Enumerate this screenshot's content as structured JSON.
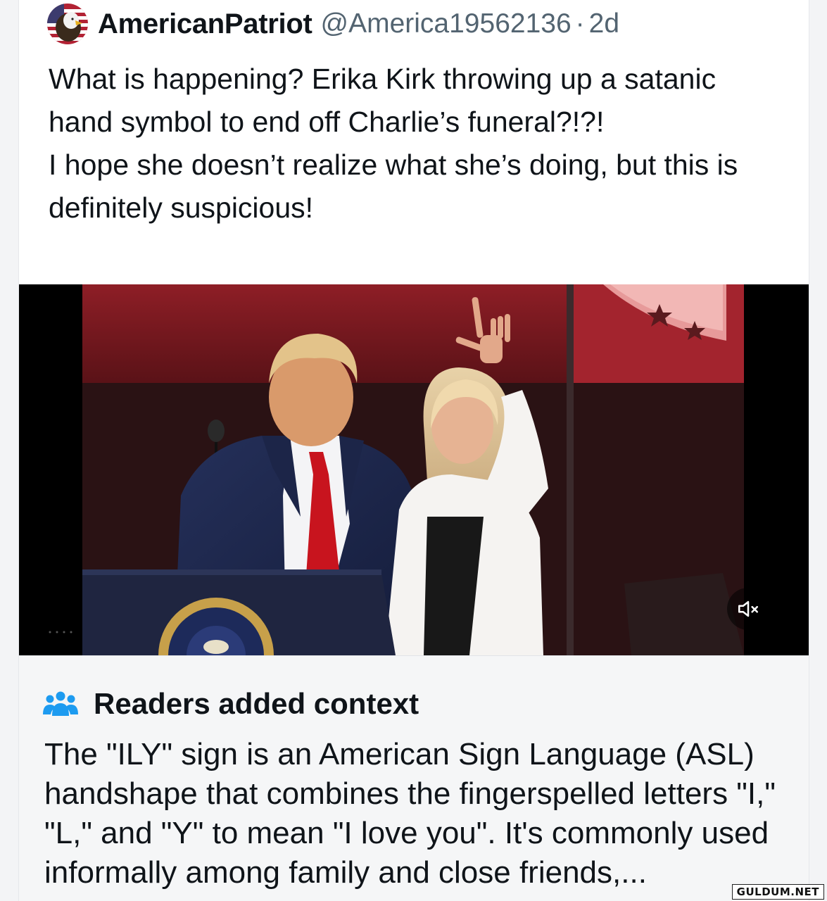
{
  "tweet": {
    "display_name": "AmericanPatriot",
    "handle": "@America19562136",
    "separator": "·",
    "age": "2d",
    "avatar_icon": "eagle-flag-avatar",
    "text_paragraphs": [
      "What is happening? Erika Kirk throwing up a satanic hand symbol to end off Charlie’s funeral?!?!",
      "I hope she doesn’t realize what she’s doing, but this is definitely suspicious!"
    ]
  },
  "media": {
    "type": "video",
    "mute_icon": "speaker-muted-icon"
  },
  "community_note": {
    "icon": "people-icon",
    "title": "Readers added context",
    "body": "The \"ILY\" sign is an American Sign Language (ASL) handshape that combines the fingerspelled letters \"I,\" \"L,\" and \"Y\" to mean \"I love you\". It's commonly used informally among family and close friends,..."
  },
  "watermark": "GULDUM.NET",
  "colors": {
    "accent_blue": "#1d9bf0",
    "secondary_text": "#536471",
    "primary_text": "#0f1419"
  }
}
